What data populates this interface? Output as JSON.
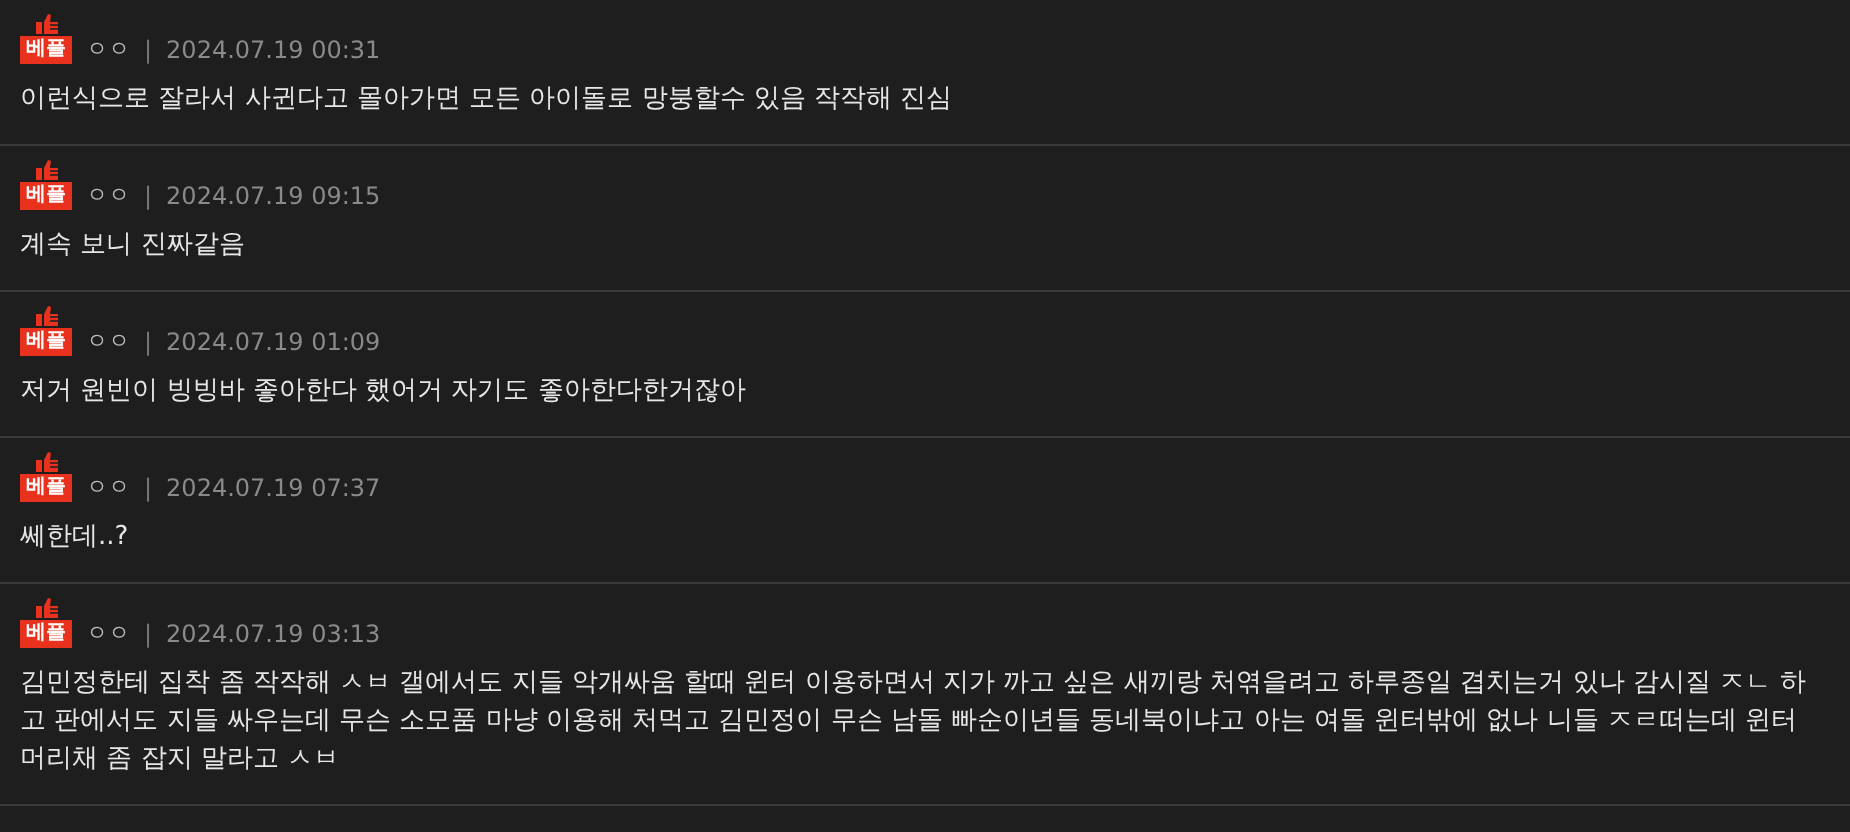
{
  "comments": [
    {
      "badge": "베플",
      "author": "ㅇㅇ",
      "separator": "|",
      "date": "2024.07.19 00:31",
      "text": "이런식으로 잘라서 사귄다고 몰아가면 모든 아이돌로 망붕할수 있음 작작해 진심"
    },
    {
      "badge": "베플",
      "author": "ㅇㅇ",
      "separator": "|",
      "date": "2024.07.19 09:15",
      "text": "계속 보니 진짜같음"
    },
    {
      "badge": "베플",
      "author": "ㅇㅇ",
      "separator": "|",
      "date": "2024.07.19 01:09",
      "text": "저거 원빈이 빙빙바 좋아한다 했어거 자기도 좋아한다한거잖아"
    },
    {
      "badge": "베플",
      "author": "ㅇㅇ",
      "separator": "|",
      "date": "2024.07.19 07:37",
      "text": "쎄한데..?"
    },
    {
      "badge": "베플",
      "author": "ㅇㅇ",
      "separator": "|",
      "date": "2024.07.19 03:13",
      "text": "김민정한테 집착 좀 작작해 ㅅㅂ 갤에서도 지들 악개싸움 할때 윈터 이용하면서 지가 까고 싶은 새끼랑 처엮을려고 하루종일 겹치는거 있나 감시질 ㅈㄴ 하고 판에서도 지들 싸우는데 무슨 소모품 마냥 이용해 처먹고 김민정이 무슨 남돌 빠순이년들 동네북이냐고 아는 여돌 윈터밖에 없나 니들 ㅈㄹ떠는데 윈터 머리채 좀 잡지 말라고 ㅅㅂ"
    }
  ]
}
